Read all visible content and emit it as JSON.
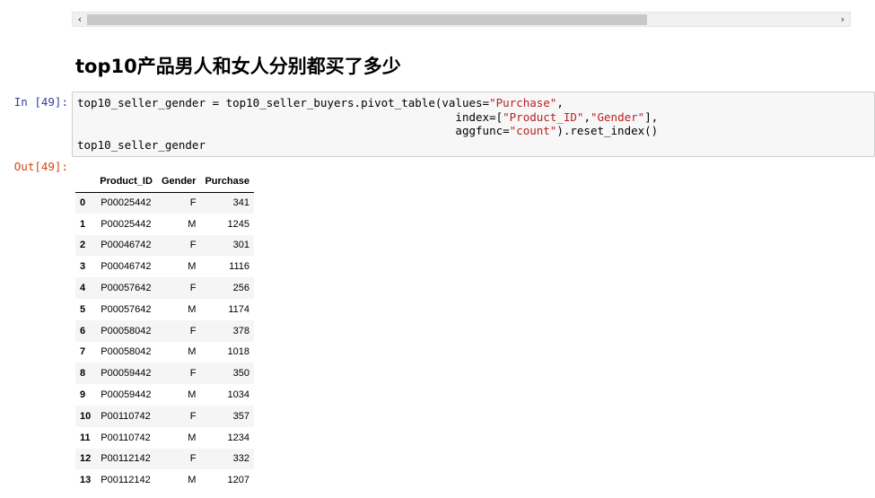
{
  "scrollbar": {
    "left_arrow": "‹",
    "right_arrow": "›"
  },
  "heading": "top10产品男人和女人分别都买了多少",
  "input_prompt": "In [49]:",
  "output_prompt": "Out[49]:",
  "code": {
    "l1_a": "top10_seller_gender = top10_seller_buyers.pivot_table(values=",
    "l1_s1": "\"Purchase\"",
    "l1_b": ",",
    "l2_a": "                                                        index=[",
    "l2_s1": "\"Product_ID\"",
    "l2_b": ",",
    "l2_s2": "\"Gender\"",
    "l2_c": "],",
    "l3_a": "                                                        aggfunc=",
    "l3_s1": "\"count\"",
    "l3_b": ").reset_index()",
    "l4": "top10_seller_gender"
  },
  "table": {
    "columns": [
      "",
      "Product_ID",
      "Gender",
      "Purchase"
    ],
    "rows": [
      {
        "index": "0",
        "product_id": "P00025442",
        "gender": "F",
        "purchase": "341"
      },
      {
        "index": "1",
        "product_id": "P00025442",
        "gender": "M",
        "purchase": "1245"
      },
      {
        "index": "2",
        "product_id": "P00046742",
        "gender": "F",
        "purchase": "301"
      },
      {
        "index": "3",
        "product_id": "P00046742",
        "gender": "M",
        "purchase": "1116"
      },
      {
        "index": "4",
        "product_id": "P00057642",
        "gender": "F",
        "purchase": "256"
      },
      {
        "index": "5",
        "product_id": "P00057642",
        "gender": "M",
        "purchase": "1174"
      },
      {
        "index": "6",
        "product_id": "P00058042",
        "gender": "F",
        "purchase": "378"
      },
      {
        "index": "7",
        "product_id": "P00058042",
        "gender": "M",
        "purchase": "1018"
      },
      {
        "index": "8",
        "product_id": "P00059442",
        "gender": "F",
        "purchase": "350"
      },
      {
        "index": "9",
        "product_id": "P00059442",
        "gender": "M",
        "purchase": "1034"
      },
      {
        "index": "10",
        "product_id": "P00110742",
        "gender": "F",
        "purchase": "357"
      },
      {
        "index": "11",
        "product_id": "P00110742",
        "gender": "M",
        "purchase": "1234"
      },
      {
        "index": "12",
        "product_id": "P00112142",
        "gender": "F",
        "purchase": "332"
      },
      {
        "index": "13",
        "product_id": "P00112142",
        "gender": "M",
        "purchase": "1207"
      }
    ]
  },
  "colors": {
    "input_prompt": "#303F9F",
    "output_prompt": "#D84315",
    "string": "#BA2121"
  }
}
